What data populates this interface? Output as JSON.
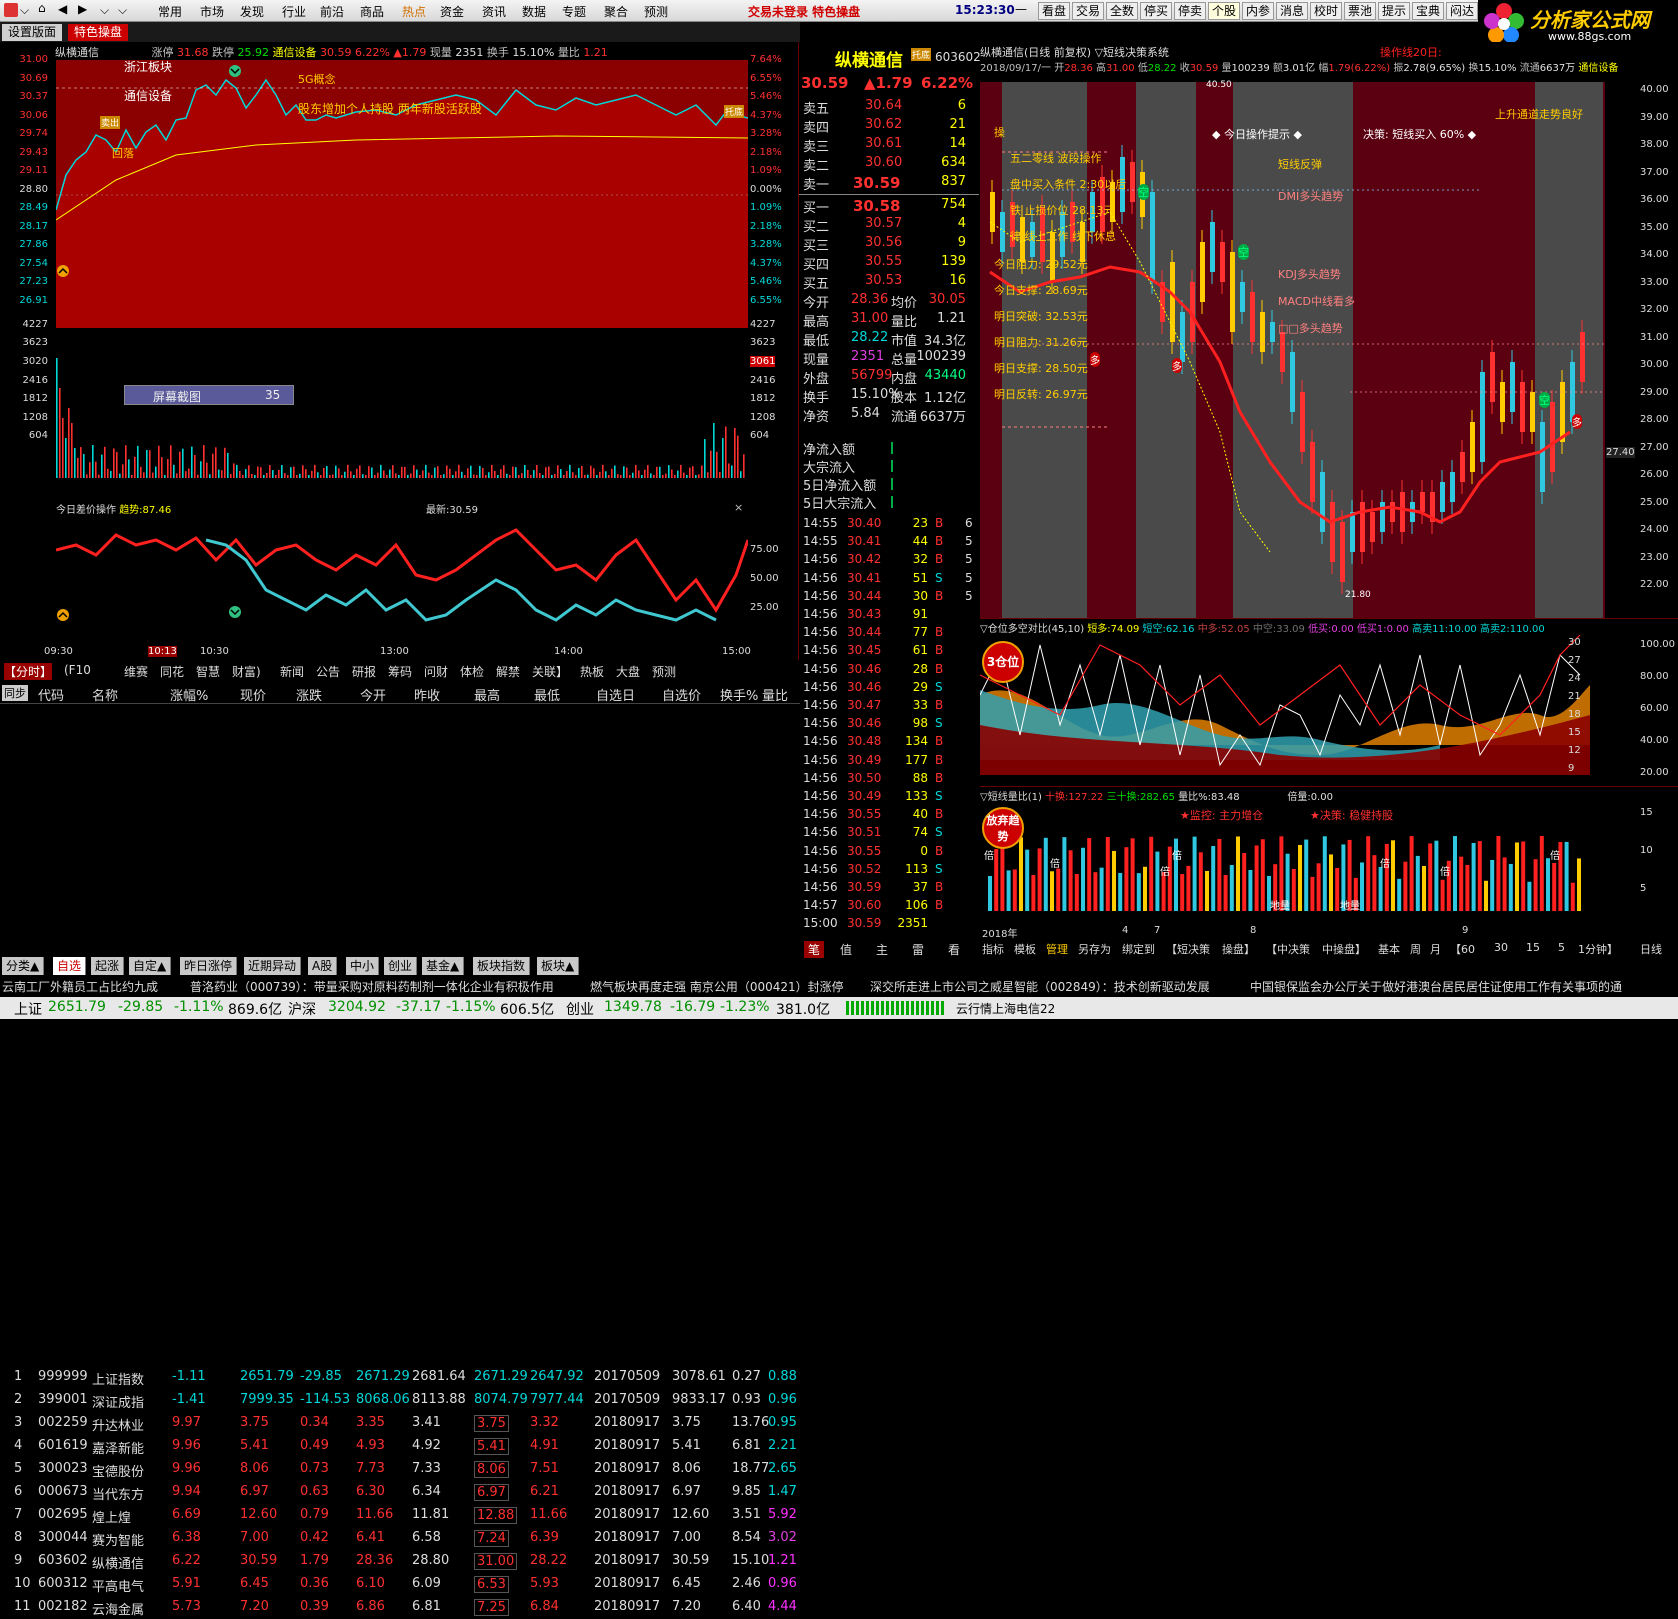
{
  "menu": {
    "items": [
      "常用",
      "市场",
      "发现",
      "行业",
      "前沿",
      "商品",
      "热点",
      "资金",
      "资讯",
      "数据",
      "专题",
      "聚合",
      "预测"
    ],
    "status": "交易未登录  特色操盘",
    "time": "15:23:30",
    "toolbar": [
      "看盘",
      "交易",
      "全数",
      "停买",
      "停卖",
      "个股",
      "内参",
      "消息",
      "校时",
      "票池",
      "提示",
      "宝典",
      "闷达"
    ],
    "logo_name": "分析家公式网",
    "logo_url": "www.88gs.com"
  },
  "subtabs": [
    "设置版面",
    "特色操盘"
  ],
  "intraday": {
    "title": "纵横通信",
    "zt_label": "涨停",
    "zt": "31.68",
    "dt_label": "跌停",
    "dt": "25.92",
    "sector": "通信设备",
    "price": "30.59",
    "pct": "6.22%",
    "chg": "▲1.79",
    "vol_label": "现量",
    "vol": "2351",
    "turn_label": "换手",
    "turn": "15.10%",
    "vr_label": "量比",
    "vr": "1.21",
    "notes": [
      "浙江板块",
      "通信设备",
      "5G概念",
      "股东增加个人持股 两年新股活跃股",
      "回落",
      "卖出",
      "托底"
    ],
    "left_axis": [
      "31.00",
      "30.69",
      "30.37",
      "30.06",
      "29.74",
      "29.43",
      "29.11",
      "28.80",
      "28.49",
      "28.17",
      "27.86",
      "27.54",
      "27.23",
      "26.91",
      "4227",
      "3623",
      "3020",
      "2416",
      "1812",
      "1208",
      "604"
    ],
    "right_axis": [
      "7.64%",
      "6.55%",
      "5.46%",
      "4.37%",
      "3.28%",
      "2.18%",
      "1.09%",
      "0.00%",
      "1.09%",
      "2.18%",
      "3.28%",
      "4.37%",
      "5.46%",
      "6.55%",
      "4227",
      "3623",
      "3061",
      "2416",
      "1812",
      "1208",
      "604"
    ],
    "popup": {
      "label": "屏幕截图",
      "value": "35"
    },
    "osc_title": "今日差价操作",
    "osc_trend": "趋势:87.46",
    "osc_latest": "最新:30.59",
    "osc_axis": [
      "75.00",
      "50.00",
      "25.00"
    ],
    "times": [
      "09:30",
      "10:13",
      "10:30",
      "13:00",
      "14:00",
      "15:00"
    ]
  },
  "quote": {
    "name": "纵横通信",
    "code": "603602",
    "price": "30.59",
    "chg": "▲1.79",
    "pct": "6.22%",
    "sells": [
      [
        "卖五",
        "30.64",
        "6"
      ],
      [
        "卖四",
        "30.62",
        "21"
      ],
      [
        "卖三",
        "30.61",
        "14"
      ],
      [
        "卖二",
        "30.60",
        "634"
      ],
      [
        "卖一",
        "30.59",
        "837"
      ]
    ],
    "buys": [
      [
        "买一",
        "30.58",
        "754"
      ],
      [
        "买二",
        "30.57",
        "4"
      ],
      [
        "买三",
        "30.56",
        "9"
      ],
      [
        "买四",
        "30.55",
        "139"
      ],
      [
        "买五",
        "30.53",
        "16"
      ]
    ],
    "stats": [
      [
        "今开",
        "28.36",
        "均价",
        "30.05"
      ],
      [
        "最高",
        "31.00",
        "量比",
        "1.21"
      ],
      [
        "最低",
        "28.22",
        "市值",
        "34.3亿"
      ],
      [
        "现量",
        "2351",
        "总量",
        "100239"
      ],
      [
        "外盘",
        "56799",
        "内盘",
        "43440"
      ],
      [
        "换手",
        "15.10%",
        "股本",
        "1.12亿"
      ],
      [
        "净资",
        "5.84",
        "流通",
        "6637万"
      ]
    ],
    "flows": [
      "净流入额",
      "大宗流入",
      "5日净流入额",
      "5日大宗流入"
    ],
    "ticks": [
      [
        "14:55",
        "30.40",
        "23",
        "B",
        "6"
      ],
      [
        "14:55",
        "30.41",
        "44",
        "B",
        "5"
      ],
      [
        "14:56",
        "30.42",
        "32",
        "B",
        "5"
      ],
      [
        "14:56",
        "30.41",
        "51",
        "S",
        "5"
      ],
      [
        "14:56",
        "30.44",
        "30",
        "B",
        "5"
      ],
      [
        "14:56",
        "30.43",
        "91",
        "",
        ""
      ],
      [
        "14:56",
        "30.44",
        "77",
        "B",
        ""
      ],
      [
        "14:56",
        "30.45",
        "61",
        "B",
        ""
      ],
      [
        "14:56",
        "30.46",
        "28",
        "B",
        ""
      ],
      [
        "14:56",
        "30.46",
        "29",
        "S",
        ""
      ],
      [
        "14:56",
        "30.47",
        "33",
        "B",
        ""
      ],
      [
        "14:56",
        "30.46",
        "98",
        "S",
        ""
      ],
      [
        "14:56",
        "30.48",
        "134",
        "B",
        ""
      ],
      [
        "14:56",
        "30.49",
        "177",
        "B",
        ""
      ],
      [
        "14:56",
        "30.50",
        "88",
        "B",
        ""
      ],
      [
        "14:56",
        "30.49",
        "133",
        "S",
        ""
      ],
      [
        "14:56",
        "30.55",
        "40",
        "B",
        ""
      ],
      [
        "14:56",
        "30.51",
        "74",
        "S",
        ""
      ],
      [
        "14:56",
        "30.55",
        "0",
        "B",
        ""
      ],
      [
        "14:56",
        "30.52",
        "113",
        "S",
        ""
      ],
      [
        "14:56",
        "30.59",
        "37",
        "B",
        ""
      ],
      [
        "14:57",
        "30.60",
        "106",
        "B",
        ""
      ],
      [
        "15:00",
        "30.59",
        "2351",
        "",
        " "
      ]
    ]
  },
  "kline": {
    "header": "纵横通信(日线 前复权) ▽短线决策系统",
    "date": "2018/09/17/一",
    "open_l": "开",
    "open": "28.36",
    "high_l": "高",
    "high": "31.00",
    "low_l": "低",
    "low": "28.22",
    "close_l": "收",
    "close": "30.59",
    "vol_l": "量",
    "vol": "100239",
    "amt_l": "额",
    "amt": "3.01亿",
    "amp_l": "幅",
    "amp": "1.79(6.22%)",
    "sw_l": "振",
    "sw": "2.78(9.65%)",
    "hs_l": "换",
    "hs": "15.10%",
    "lt_l": "流通",
    "lt": "6637万",
    "ind": "通信设备",
    "op_line": "操作线20日:",
    "notes": [
      "操",
      "五二零线 波段操作",
      "盘中买入条件 2:30以后",
      "铁 止损价位 28.13元",
      "律 线上工作 线下休息",
      "今日阻力: 29.52元",
      "今日支撑: 28.69元",
      "明日突破: 32.53元",
      "明日阻力: 31.26元",
      "明日支撑: 28.50元",
      "明日反转: 26.97元"
    ],
    "tips": [
      "◆ 今日操作提示 ◆",
      "决策: 短线买入 60% ◆",
      "短线反弹",
      "DMI多头趋势",
      "KDJ多头趋势",
      "MACD中线看多",
      "□□多头趋势",
      "上升通道走势良好"
    ],
    "hl": [
      "40.50",
      "21.80"
    ],
    "marks": [
      "空",
      "空",
      "空",
      "多",
      "多",
      "多"
    ],
    "axis": [
      "40.00",
      "39.00",
      "38.00",
      "37.00",
      "36.00",
      "35.00",
      "34.00",
      "33.00",
      "32.00",
      "31.00",
      "30.00",
      "29.00",
      "28.00",
      "27.00",
      "26.00",
      "25.00",
      "24.00",
      "23.00",
      "22.00"
    ],
    "cur": "27.40"
  },
  "pos": {
    "title": "▽仓位多空对比(45,10)",
    "dd": "短多:74.09",
    "dk": "短空:62.16",
    "zd": "中多:52.05",
    "zk": "中空:33.09",
    "dm": "低买:0.00",
    "dm2": "低买1:0.00",
    "gm": "高卖11:10.00",
    "gm2": "高卖2:110.00",
    "badge": "3仓位",
    "axis": [
      "30",
      "27",
      "24",
      "21",
      "18",
      "15",
      "12",
      "9"
    ],
    "raxis": [
      "100.00",
      "80.00",
      "60.00",
      "40.00",
      "20.00"
    ]
  },
  "vr": {
    "title": "▽短线量比(1)",
    "a": "十换:127.22",
    "b": "三十换:282.65",
    "c": "量比%:83.48",
    "d": "倍量:0.00",
    "e": "★监控: 主力增仓",
    "f": "★决策: 稳健持股",
    "badge": "放弃趋势",
    "beis": [
      "倍",
      "倍",
      "倍",
      "倍",
      "倍",
      "倍",
      "倍"
    ],
    "low": [
      "地量",
      "地量"
    ],
    "raxis": [
      "15",
      "10",
      "5"
    ],
    "dates": [
      "2018年",
      "4",
      "7",
      "8",
      "9"
    ]
  },
  "kbar": {
    "tabs": [
      "指标",
      "模板",
      "管理",
      "另存为",
      "绑定到",
      "【短决策",
      "操盘】",
      "【中决策",
      "中操盘】",
      "基本",
      "周",
      "月",
      "【60",
      "30",
      "15",
      "5",
      "1分钟】"
    ],
    "right": "日线"
  },
  "bar_mid": [
    "笔",
    "值",
    "主",
    "雷",
    "看"
  ],
  "table": {
    "tabs": [
      "【分时】",
      "(F10",
      "维赛",
      "同花",
      "智慧",
      "财富)",
      "新闻",
      "公告",
      "研报",
      "筹码",
      "问财",
      "体检",
      "解禁",
      "关联】",
      "热板",
      "大盘",
      "预测"
    ],
    "cols": [
      "代码",
      "名称",
      "涨幅%",
      "现价",
      "涨跌",
      "今开",
      "昨收",
      "最高",
      "最低",
      "自选日",
      "自选价",
      "换手%",
      "量比"
    ],
    "rows": [
      [
        "1",
        "999999",
        "上证指数",
        "-1.11",
        "2651.79",
        "-29.85",
        "2671.29",
        "2681.64",
        "2671.29",
        "2647.92",
        "20170509",
        "3078.61",
        "0.27",
        "0.88"
      ],
      [
        "2",
        "399001",
        "深证成指",
        "-1.41",
        "7999.35",
        "-114.53",
        "8068.06",
        "8113.88",
        "8074.79",
        "7977.44",
        "20170509",
        "9833.17",
        "0.93",
        "0.96"
      ],
      [
        "3",
        "002259",
        "升达林业",
        "9.97",
        "3.75",
        "0.34",
        "3.35",
        "3.41",
        "3.75",
        "3.32",
        "20180917",
        "3.75",
        "13.76",
        "0.95"
      ],
      [
        "4",
        "601619",
        "嘉泽新能",
        "9.96",
        "5.41",
        "0.49",
        "4.93",
        "4.92",
        "5.41",
        "4.91",
        "20180917",
        "5.41",
        "6.81",
        "2.21"
      ],
      [
        "5",
        "300023",
        "宝德股份",
        "9.96",
        "8.06",
        "0.73",
        "7.73",
        "7.33",
        "8.06",
        "7.51",
        "20180917",
        "8.06",
        "18.77",
        "2.65"
      ],
      [
        "6",
        "000673",
        "当代东方",
        "9.94",
        "6.97",
        "0.63",
        "6.30",
        "6.34",
        "6.97",
        "6.21",
        "20180917",
        "6.97",
        "9.85",
        "1.47"
      ],
      [
        "7",
        "002695",
        "煌上煌",
        "6.69",
        "12.60",
        "0.79",
        "11.66",
        "11.81",
        "12.88",
        "11.66",
        "20180917",
        "12.60",
        "3.51",
        "5.92"
      ],
      [
        "8",
        "300044",
        "赛为智能",
        "6.38",
        "7.00",
        "0.42",
        "6.41",
        "6.58",
        "7.24",
        "6.39",
        "20180917",
        "7.00",
        "8.54",
        "3.02"
      ],
      [
        "9",
        "603602",
        "纵横通信",
        "6.22",
        "30.59",
        "1.79",
        "28.36",
        "28.80",
        "31.00",
        "28.22",
        "20180917",
        "30.59",
        "15.10",
        "1.21"
      ],
      [
        "10",
        "600312",
        "平高电气",
        "5.91",
        "6.45",
        "0.36",
        "6.10",
        "6.09",
        "6.53",
        "5.93",
        "20180917",
        "6.45",
        "2.46",
        "0.96"
      ],
      [
        "11",
        "002182",
        "云海金属",
        "5.73",
        "7.20",
        "0.39",
        "6.86",
        "6.81",
        "7.25",
        "6.84",
        "20180917",
        "7.20",
        "6.40",
        "4.44"
      ]
    ],
    "bottom_tabs": [
      "分类▲",
      "自选",
      "起涨",
      "自定▲",
      "昨日涨停",
      "近期异动",
      "A股",
      "中小",
      "创业",
      "基金▲",
      "板块指数",
      "板块▲"
    ]
  },
  "news": [
    "云南工厂外籍员工占比约九成",
    "普洛药业（000739）：带量采购对原料药制剂一体化企业有积极作用",
    "燃气板块再度走强 南京公用（000421）封涨停",
    "深交所走进上市公司之威星智能（002849）：技术创新驱动发展",
    "中国银保监会办公厅关于做好港澳台居民居住证使用工作有关事项的通"
  ],
  "ticker": {
    "sh_l": "上证",
    "sh": "2651.79",
    "sh_c": "-29.85",
    "sh_p": "-1.11%",
    "sh_v": "869.6亿",
    "sz_l": "沪深",
    "sz": "3204.92",
    "sz_c": "-37.17",
    "sz_p": "-1.15%",
    "sz_v": "606.5亿",
    "cy_l": "创业",
    "cy": "1349.78",
    "cy_c": "-16.79",
    "cy_p": "-1.23%",
    "cy_v": "381.0亿",
    "srv": "云行情上海电信22"
  },
  "colors": {
    "up": "#ff3030",
    "down": "#00d8d8",
    "bg": "#000000",
    "panel": "#5a0000"
  }
}
